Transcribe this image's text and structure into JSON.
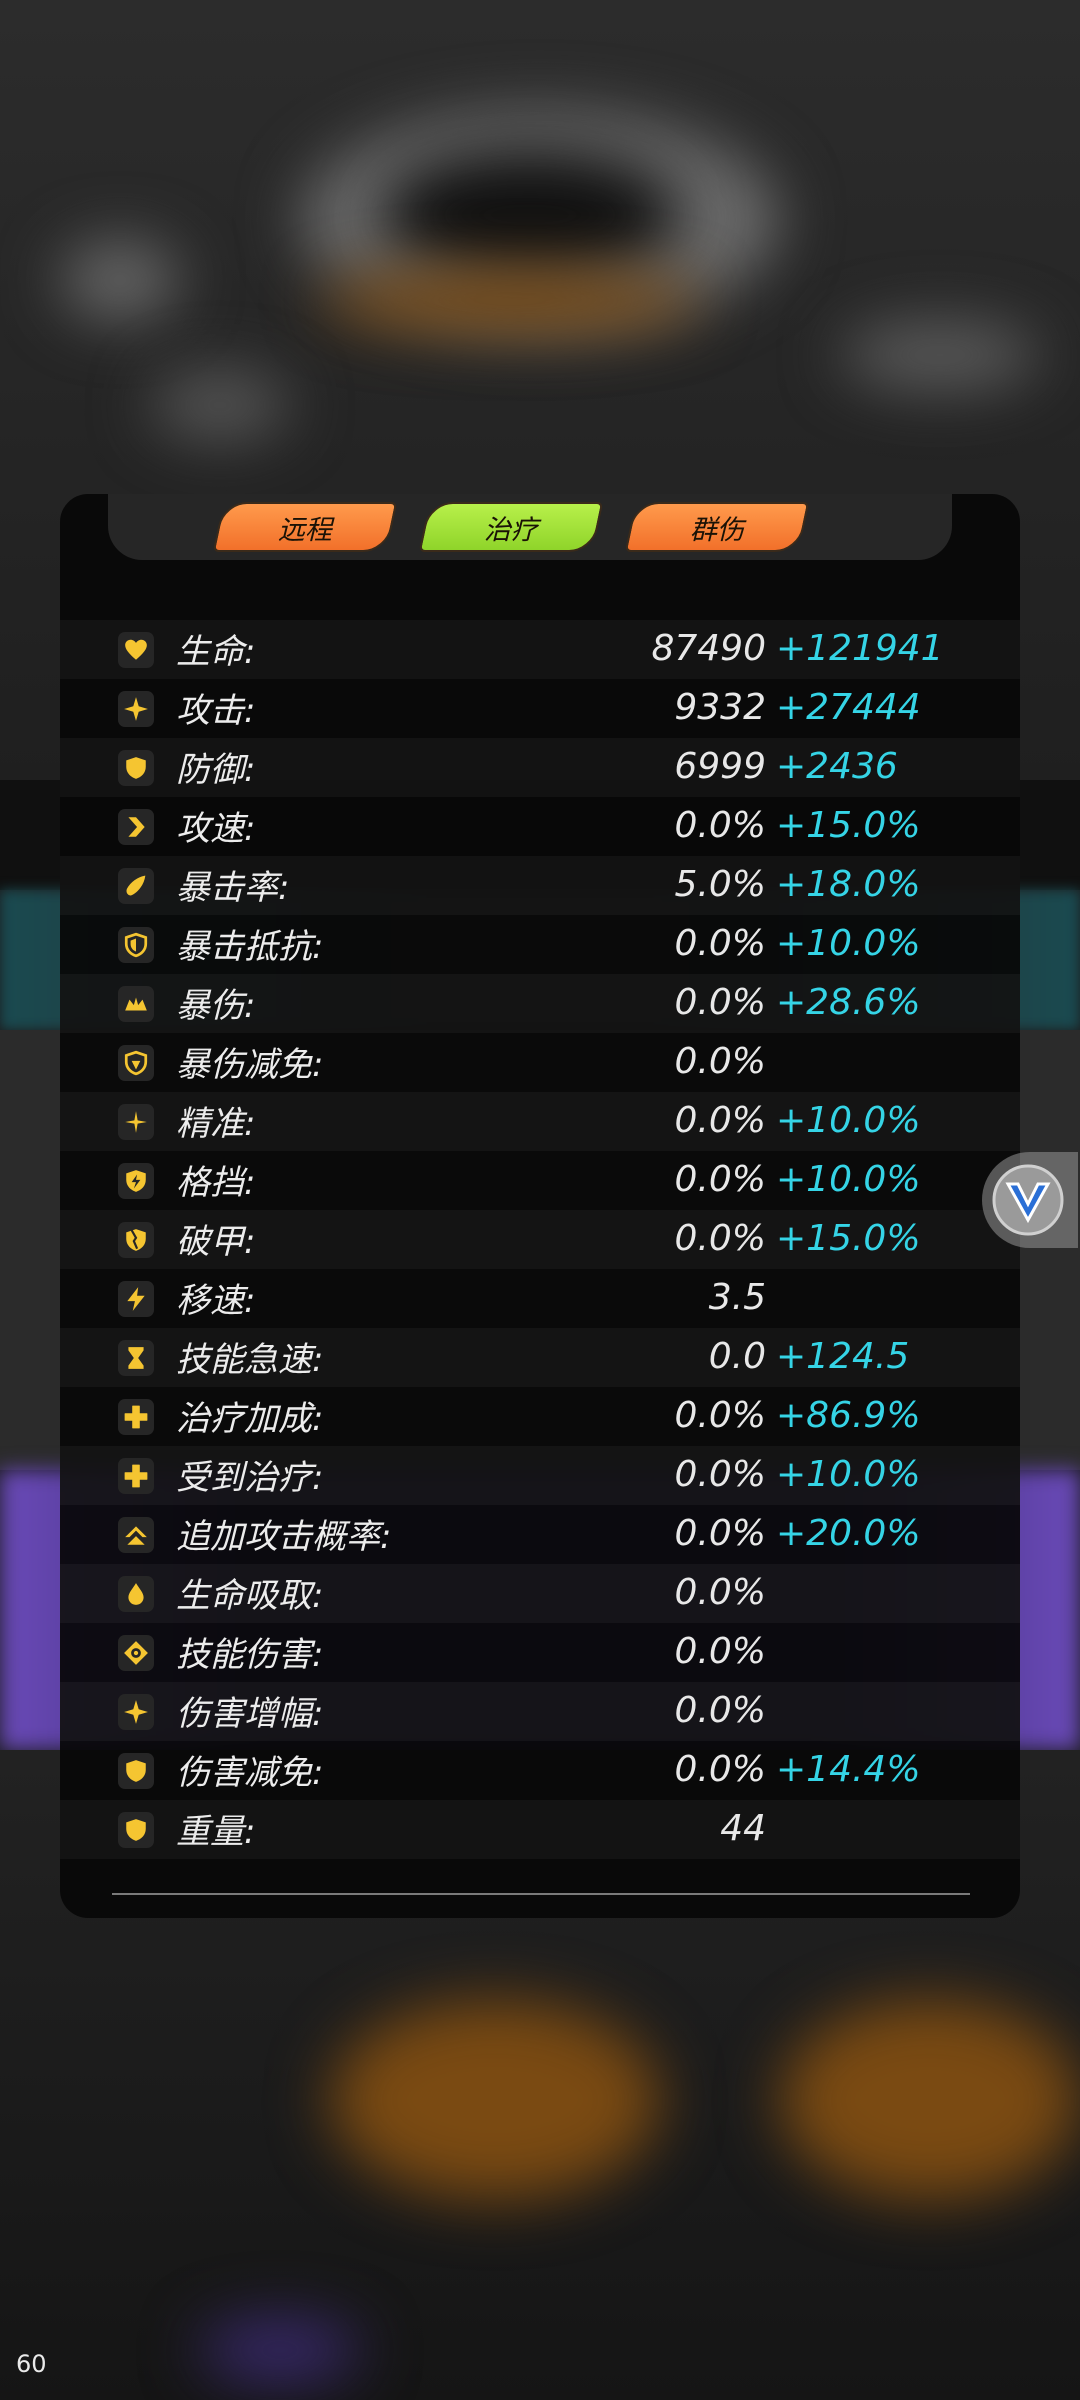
{
  "colors": {
    "accent_bonus": "#35d4e6",
    "icon_gold": "#f5c531",
    "tag_orange": "#f2702a",
    "tag_green": "#9ee23a"
  },
  "tags": [
    {
      "label": "远程",
      "color": "orange"
    },
    {
      "label": "治疗",
      "color": "green"
    },
    {
      "label": "群伤",
      "color": "orange"
    }
  ],
  "stats": [
    {
      "icon": "heart-icon",
      "label": "生命:",
      "value": "87490",
      "bonus": "+121941"
    },
    {
      "icon": "sparkle-icon",
      "label": "攻击:",
      "value": "9332",
      "bonus": "+27444"
    },
    {
      "icon": "shield-icon",
      "label": "防御:",
      "value": "6999",
      "bonus": "+2436"
    },
    {
      "icon": "chevron-right-icon",
      "label": "攻速:",
      "value": "0.0%",
      "bonus": "+15.0%"
    },
    {
      "icon": "comet-icon",
      "label": "暴击率:",
      "value": "5.0%",
      "bonus": "+18.0%"
    },
    {
      "icon": "shield-outline-icon",
      "label": "暴击抵抗:",
      "value": "0.0%",
      "bonus": "+10.0%"
    },
    {
      "icon": "crown-icon",
      "label": "暴伤:",
      "value": "0.0%",
      "bonus": "+28.6%"
    },
    {
      "icon": "shield-half-icon",
      "label": "暴伤减免:",
      "value": "0.0%",
      "bonus": ""
    },
    {
      "icon": "crosshair-sparkle-icon",
      "label": "精准:",
      "value": "0.0%",
      "bonus": "+10.0%"
    },
    {
      "icon": "shield-bolt-icon",
      "label": "格挡:",
      "value": "0.0%",
      "bonus": "+10.0%"
    },
    {
      "icon": "broken-shield-icon",
      "label": "破甲:",
      "value": "0.0%",
      "bonus": "+15.0%"
    },
    {
      "icon": "lightning-icon",
      "label": "移速:",
      "value": "3.5",
      "bonus": ""
    },
    {
      "icon": "hourglass-icon",
      "label": "技能急速:",
      "value": "0.0",
      "bonus": "+124.5"
    },
    {
      "icon": "plus-icon",
      "label": "治疗加成:",
      "value": "0.0%",
      "bonus": "+86.9%"
    },
    {
      "icon": "plus-icon",
      "label": "受到治疗:",
      "value": "0.0%",
      "bonus": "+10.0%"
    },
    {
      "icon": "double-chevron-up-icon",
      "label": "追加攻击概率:",
      "value": "0.0%",
      "bonus": "+20.0%"
    },
    {
      "icon": "droplet-icon",
      "label": "生命吸取:",
      "value": "0.0%",
      "bonus": ""
    },
    {
      "icon": "target-icon",
      "label": "技能伤害:",
      "value": "0.0%",
      "bonus": ""
    },
    {
      "icon": "sparkle-icon",
      "label": "伤害增幅:",
      "value": "0.0%",
      "bonus": ""
    },
    {
      "icon": "shield-icon",
      "label": "伤害减免:",
      "value": "0.0%",
      "bonus": "+14.4%"
    },
    {
      "icon": "shield-icon",
      "label": "重量:",
      "value": "44",
      "bonus": ""
    }
  ],
  "fps_counter": "60"
}
